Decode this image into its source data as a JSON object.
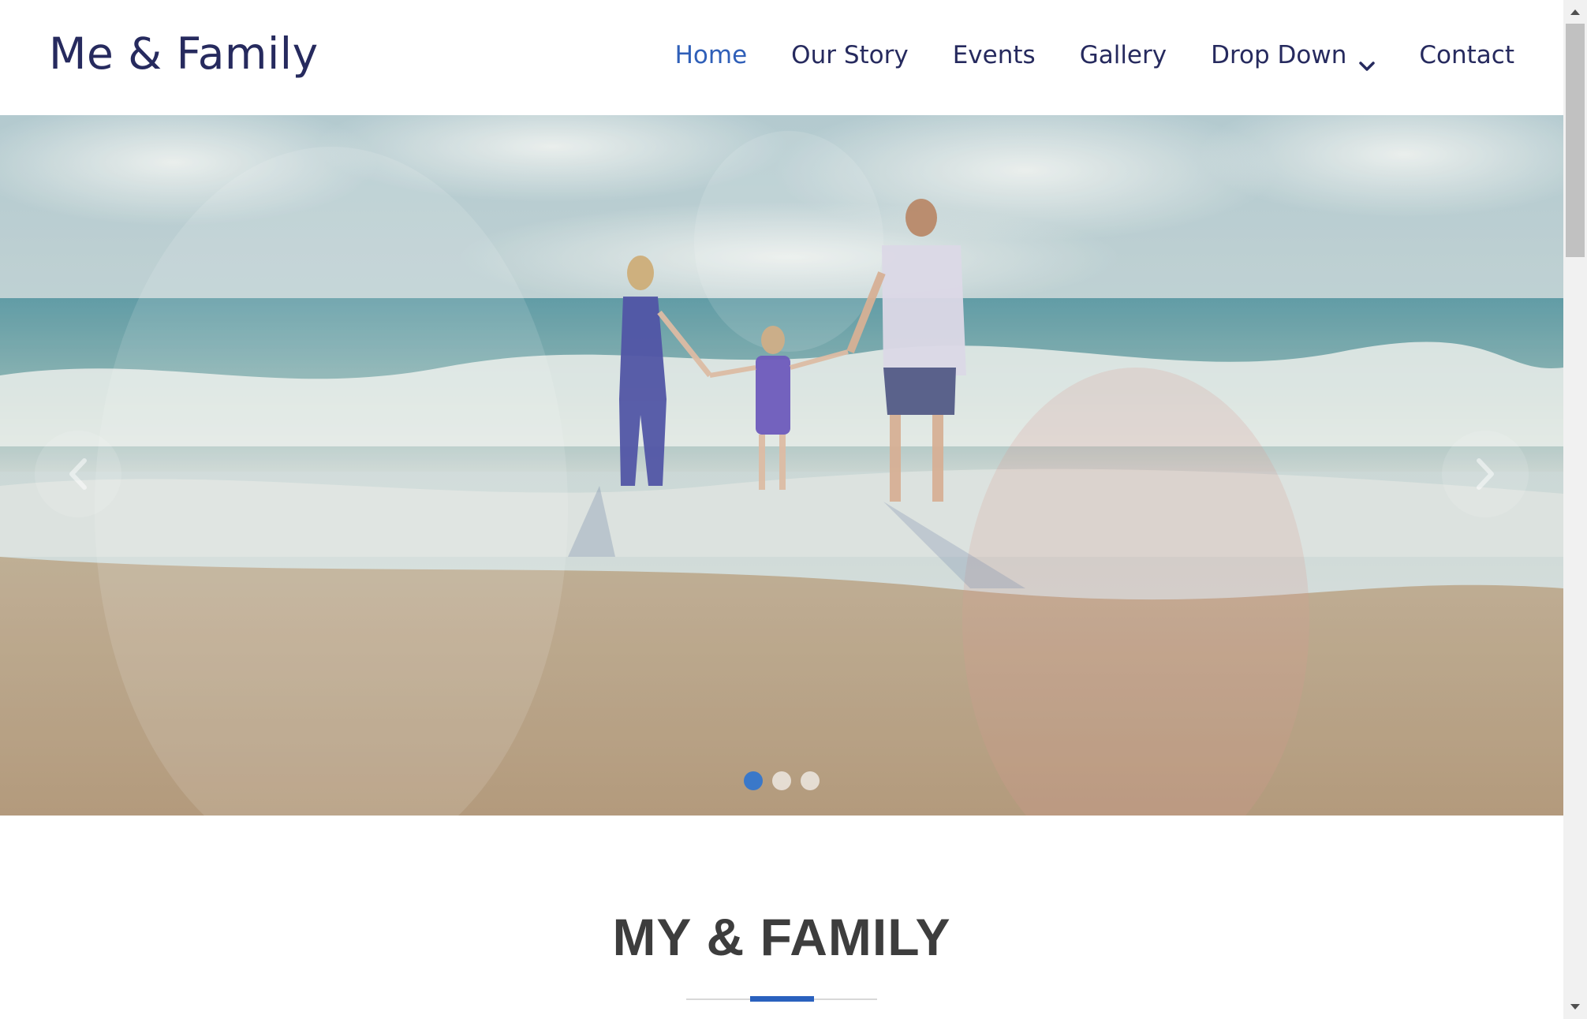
{
  "site": {
    "logo": "Me & Family"
  },
  "nav": {
    "items": [
      {
        "label": "Home",
        "active": true
      },
      {
        "label": "Our Story",
        "active": false
      },
      {
        "label": "Events",
        "active": false
      },
      {
        "label": "Gallery",
        "active": false
      },
      {
        "label": "Drop Down",
        "active": false,
        "has_dropdown": true
      },
      {
        "label": "Contact",
        "active": false
      }
    ]
  },
  "hero": {
    "slides_total": 3,
    "active_slide": 1,
    "prev_icon": "chevron-left-icon",
    "next_icon": "chevron-right-icon"
  },
  "section": {
    "title": "MY & FAMILY"
  },
  "colors": {
    "brand": "#262a5e",
    "accent": "#2f5fb8",
    "divider_accent": "#2a61be",
    "heading": "#3d3d3d"
  }
}
